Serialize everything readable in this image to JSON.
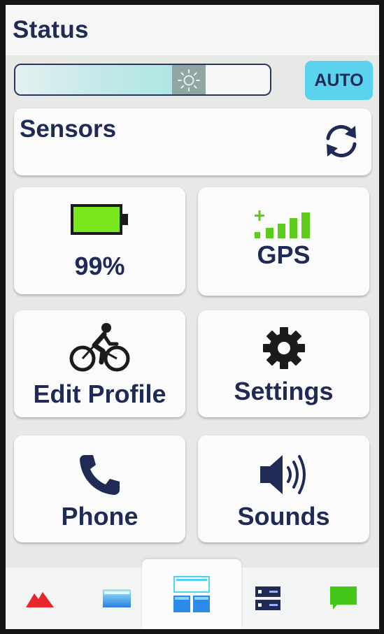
{
  "header": {
    "title": "Status"
  },
  "brightness": {
    "level": 0.68,
    "auto_label": "AUTO"
  },
  "sensors": {
    "label": "Sensors",
    "icon": "sync-icon"
  },
  "tiles": [
    {
      "id": "battery",
      "label": "99%",
      "icon": "battery-icon",
      "level": 0.99
    },
    {
      "id": "gps",
      "label": "GPS",
      "icon": "signal-bars-icon"
    },
    {
      "id": "edit-profile",
      "label": "Edit Profile",
      "icon": "cyclist-icon"
    },
    {
      "id": "settings",
      "label": "Settings",
      "icon": "gear-icon"
    },
    {
      "id": "phone",
      "label": "Phone",
      "icon": "phone-icon"
    },
    {
      "id": "sounds",
      "label": "Sounds",
      "icon": "speaker-icon"
    }
  ],
  "tabs": [
    {
      "id": "elevation",
      "icon": "mountain-icon",
      "active": false
    },
    {
      "id": "data-page",
      "icon": "single-panel-icon",
      "active": false
    },
    {
      "id": "widgets",
      "icon": "widget-grid-icon",
      "active": true
    },
    {
      "id": "controls",
      "icon": "control-panel-icon",
      "active": false
    },
    {
      "id": "messages",
      "icon": "message-icon",
      "active": false
    }
  ],
  "colors": {
    "text": "#1f2a55",
    "auto": "#5cd3ee",
    "battery_fill": "#79e81e",
    "gps_green": "#5ccb1b",
    "active_tab_blue": "#2c8be8"
  }
}
